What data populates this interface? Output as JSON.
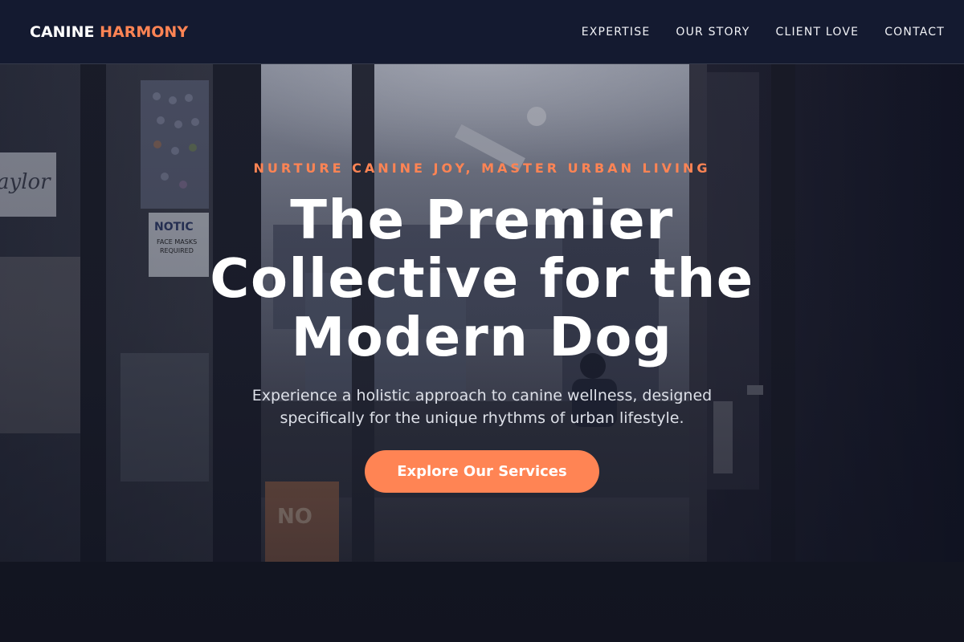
{
  "nav": {
    "logo_word_1": "CANINE",
    "logo_word_2": "HARMONY",
    "links": [
      "EXPERTISE",
      "OUR STORY",
      "CLIENT LOVE",
      "CONTACT"
    ]
  },
  "hero": {
    "tagline": "NURTURE CANINE JOY, MASTER URBAN LIVING",
    "headline": "The Premier Collective for the Modern Dog",
    "subtext": "Experience a holistic approach to canine wellness, designed specifically for the unique rhythms of urban lifestyle.",
    "cta_label": "Explore Our Services"
  },
  "background_sign_text": {
    "storefront_name": "Taylor",
    "notice_title": "NOTICE",
    "notice_body": "FACE MASKS REQUIRED",
    "no_smoking": "NO SMOKING"
  },
  "colors": {
    "accent": "#ff8454",
    "nav_background": "#141a30",
    "headline_text": "#ffffff"
  }
}
